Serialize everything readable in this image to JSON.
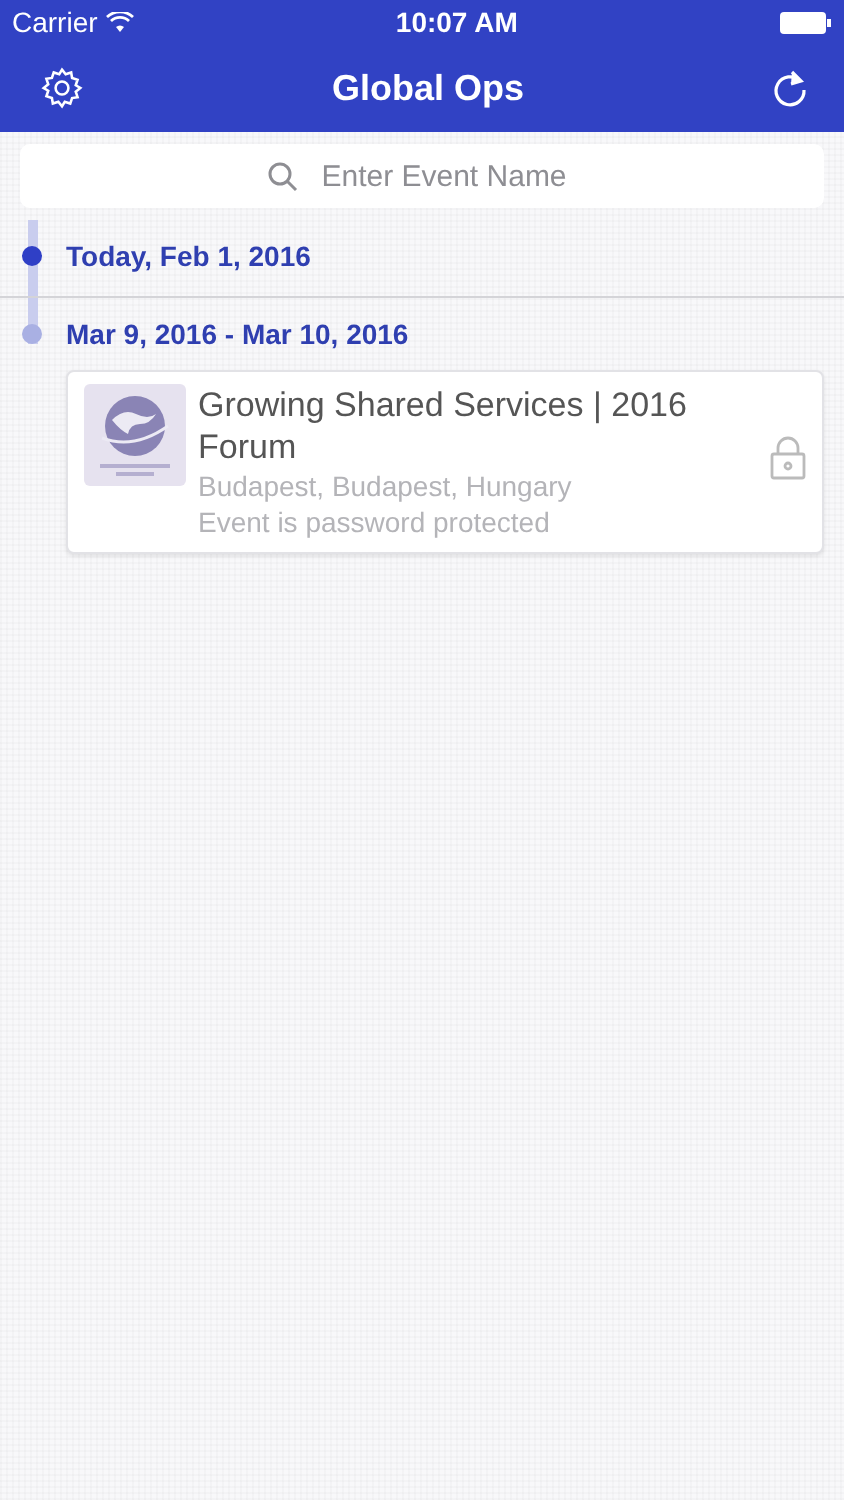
{
  "status_bar": {
    "carrier": "Carrier",
    "time": "10:07 AM"
  },
  "nav": {
    "title": "Global Ops"
  },
  "search": {
    "placeholder": "Enter Event Name"
  },
  "timeline": [
    {
      "date": "Today, Feb 1, 2016",
      "current": true
    },
    {
      "date": "Mar 9, 2016 - Mar 10, 2016",
      "current": false,
      "events": [
        {
          "title": "Growing Shared Services | 2016 Forum",
          "location": "Budapest, Budapest, Hungary",
          "note": "Event is password protected",
          "locked": true
        }
      ]
    }
  ]
}
